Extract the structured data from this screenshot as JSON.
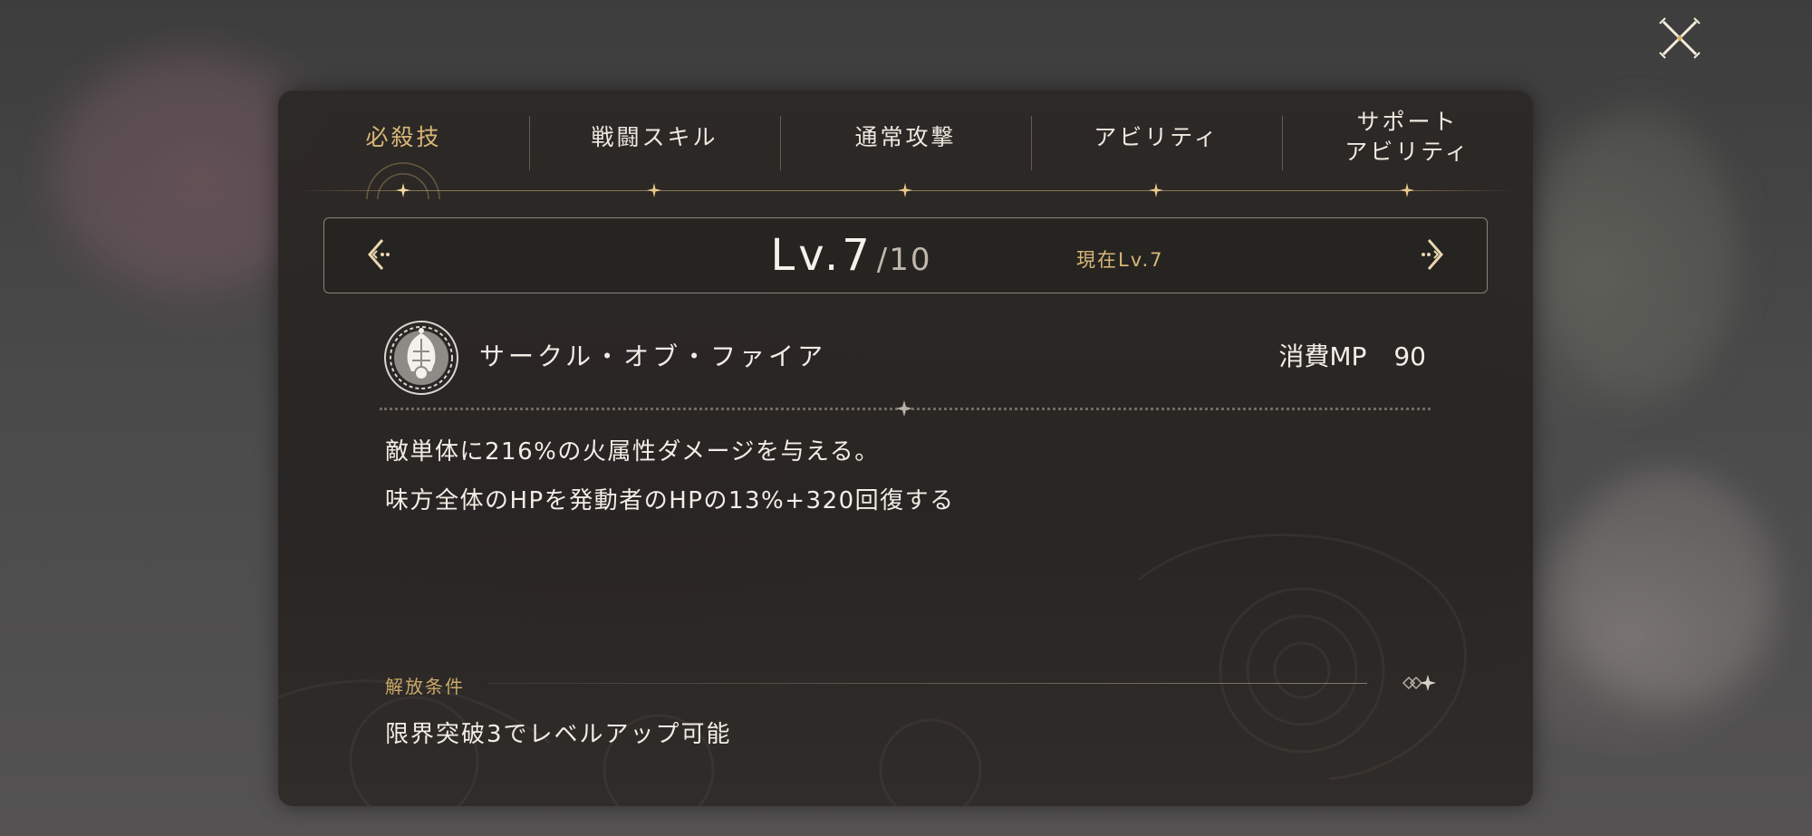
{
  "window": {
    "close_icon": "close-x-icon"
  },
  "tabs": [
    {
      "label": "必殺技",
      "active": true
    },
    {
      "label": "戦闘スキル",
      "active": false
    },
    {
      "label": "通常攻撃",
      "active": false
    },
    {
      "label": "アビリティ",
      "active": false
    },
    {
      "label": "サポート\nアビリティ",
      "active": false
    }
  ],
  "level": {
    "current": "Lv.7",
    "max": "/10",
    "now_label": "現在Lv.7",
    "prev_icon": "chevron-left-icon",
    "next_icon": "chevron-right-icon"
  },
  "skill": {
    "icon": "skill-emblem-icon",
    "name": "サークル・オブ・ファイア",
    "mp_label": "消費MP",
    "mp_value": "90",
    "description": [
      "敵単体に216%の火属性ダメージを与える。",
      "味方全体のHPを発動者のHPの13%+320回復する"
    ]
  },
  "unlock": {
    "label": "解放条件",
    "text": "限界突破3でレベルアップ可能"
  },
  "colors": {
    "accent_gold": "#d7b777",
    "text_primary": "#f2ede5",
    "panel_bg": "#2c2826"
  }
}
